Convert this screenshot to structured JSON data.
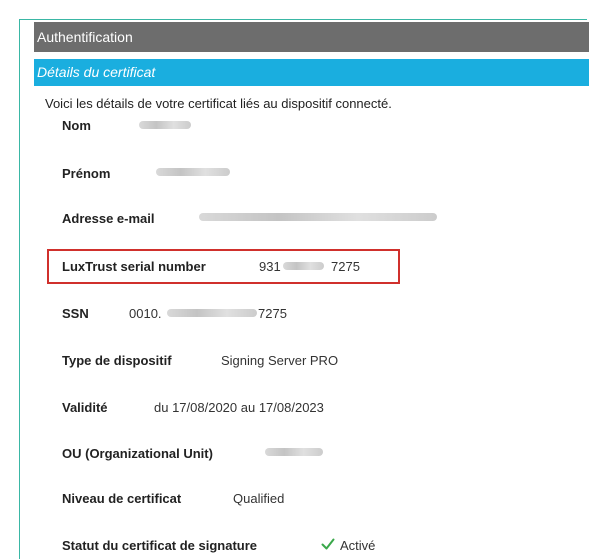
{
  "header": {
    "title": "Authentification",
    "subtitle": "Détails du certificat"
  },
  "intro": "Voici les détails de votre certificat liés au dispositif connecté.",
  "fields": {
    "nom": {
      "label": "Nom"
    },
    "prenom": {
      "label": "Prénom"
    },
    "email": {
      "label": "Adresse e-mail"
    },
    "luxtrust": {
      "label": "LuxTrust serial number",
      "prefix": "931",
      "suffix": "7275"
    },
    "ssn": {
      "label": "SSN",
      "prefix": "0010.",
      "suffix": "7275"
    },
    "type": {
      "label": "Type de dispositif",
      "value": "Signing Server PRO"
    },
    "validite": {
      "label": "Validité",
      "value": "du 17/08/2020 au 17/08/2023"
    },
    "ou": {
      "label": "OU (Organizational Unit)"
    },
    "niveau": {
      "label": "Niveau de certificat",
      "value": "Qualified"
    },
    "statut": {
      "label": "Statut du certificat de signature",
      "value": "Activé"
    }
  },
  "icons": {
    "status": "check-icon"
  },
  "colors": {
    "header_bg": "#6d6d6d",
    "subheader_bg": "#1aaedf",
    "highlight_border": "#d0302c",
    "check_green": "#3aa84a",
    "frame_border": "#3ab7a5"
  }
}
